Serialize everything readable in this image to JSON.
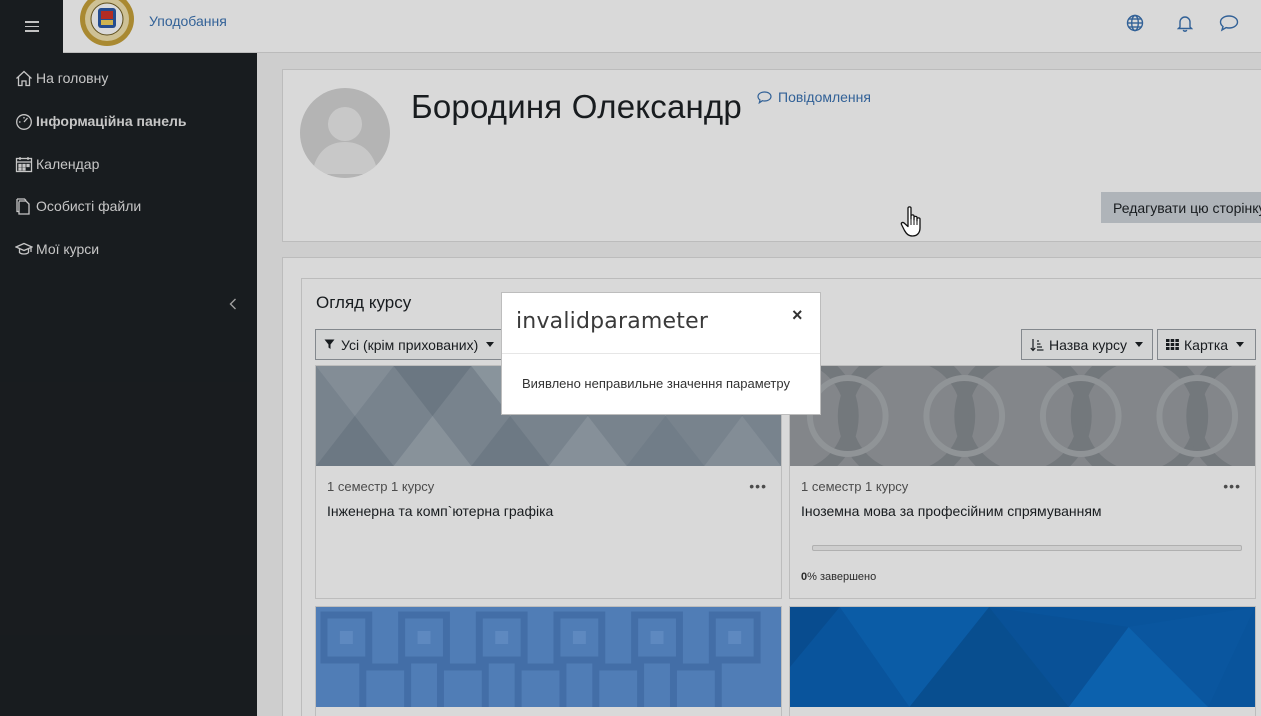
{
  "navbar": {
    "brand": "Уподобання",
    "icons": [
      "globe-icon",
      "bell-icon",
      "chat-icon"
    ]
  },
  "sidebar": {
    "items": [
      {
        "label": "На головну",
        "icon": "home-icon"
      },
      {
        "label": "Інформаційна панель",
        "icon": "dashboard-icon"
      },
      {
        "label": "Календар",
        "icon": "calendar-icon"
      },
      {
        "label": "Особисті файли",
        "icon": "files-icon"
      },
      {
        "label": "Мої курси",
        "icon": "graduation-cap-icon"
      }
    ]
  },
  "profile": {
    "name": "Бородиня Олександр",
    "message_link": "Повідомлення",
    "edit_button": "Редагувати цю сторінку"
  },
  "overview": {
    "title": "Огляд курсу",
    "filter": "Усі (крім прихованих)",
    "sort": "Назва курсу",
    "view": "Картка",
    "courses": [
      {
        "category": "1 семестр 1 курсу",
        "name": "Інженерна та комп`ютерна графіка",
        "more": "•••"
      },
      {
        "category": "1 семестр 1 курсу",
        "name": "Іноземна мова за професійним спрямуванням",
        "more": "•••",
        "progress_value": "0",
        "progress_suffix": "% завершено",
        "progress_fraction": 0
      }
    ]
  },
  "modal": {
    "title": "invalidparameter",
    "close": "×",
    "body": "Виявлено неправильне значення параметру"
  },
  "colors": {
    "sidebar_bg": "#1d2125",
    "link": "#3b73b2",
    "card_bg": "#ffffff",
    "backdrop": "rgba(0,0,0,0.15)"
  }
}
